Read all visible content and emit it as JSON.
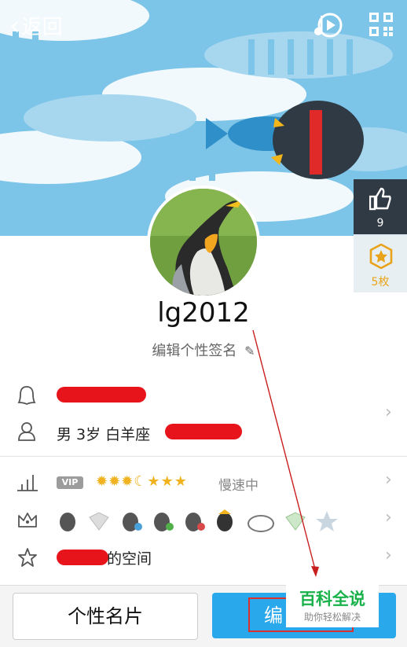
{
  "header": {
    "back_label": "返回",
    "icons": [
      "music-disc-icon",
      "qr-code-icon"
    ]
  },
  "side": {
    "like_count": "9",
    "medal_count": "5枚"
  },
  "profile": {
    "username": "lg2012",
    "signature": "编辑个性签名"
  },
  "info": {
    "gender_age_star": "男  3岁  白羊座"
  },
  "level": {
    "vip_badge": "VIP",
    "speed_status": "慢速中"
  },
  "space": {
    "suffix": "的空间"
  },
  "bottom": {
    "card_label": "个性名片",
    "edit_label": "编"
  },
  "watermark": {
    "title": "百科全说",
    "subtitle": "助你轻松解决"
  },
  "colors": {
    "banner": "#7cc4e8",
    "accent_blue": "#29a9eb",
    "redaction": "#e8141b"
  }
}
